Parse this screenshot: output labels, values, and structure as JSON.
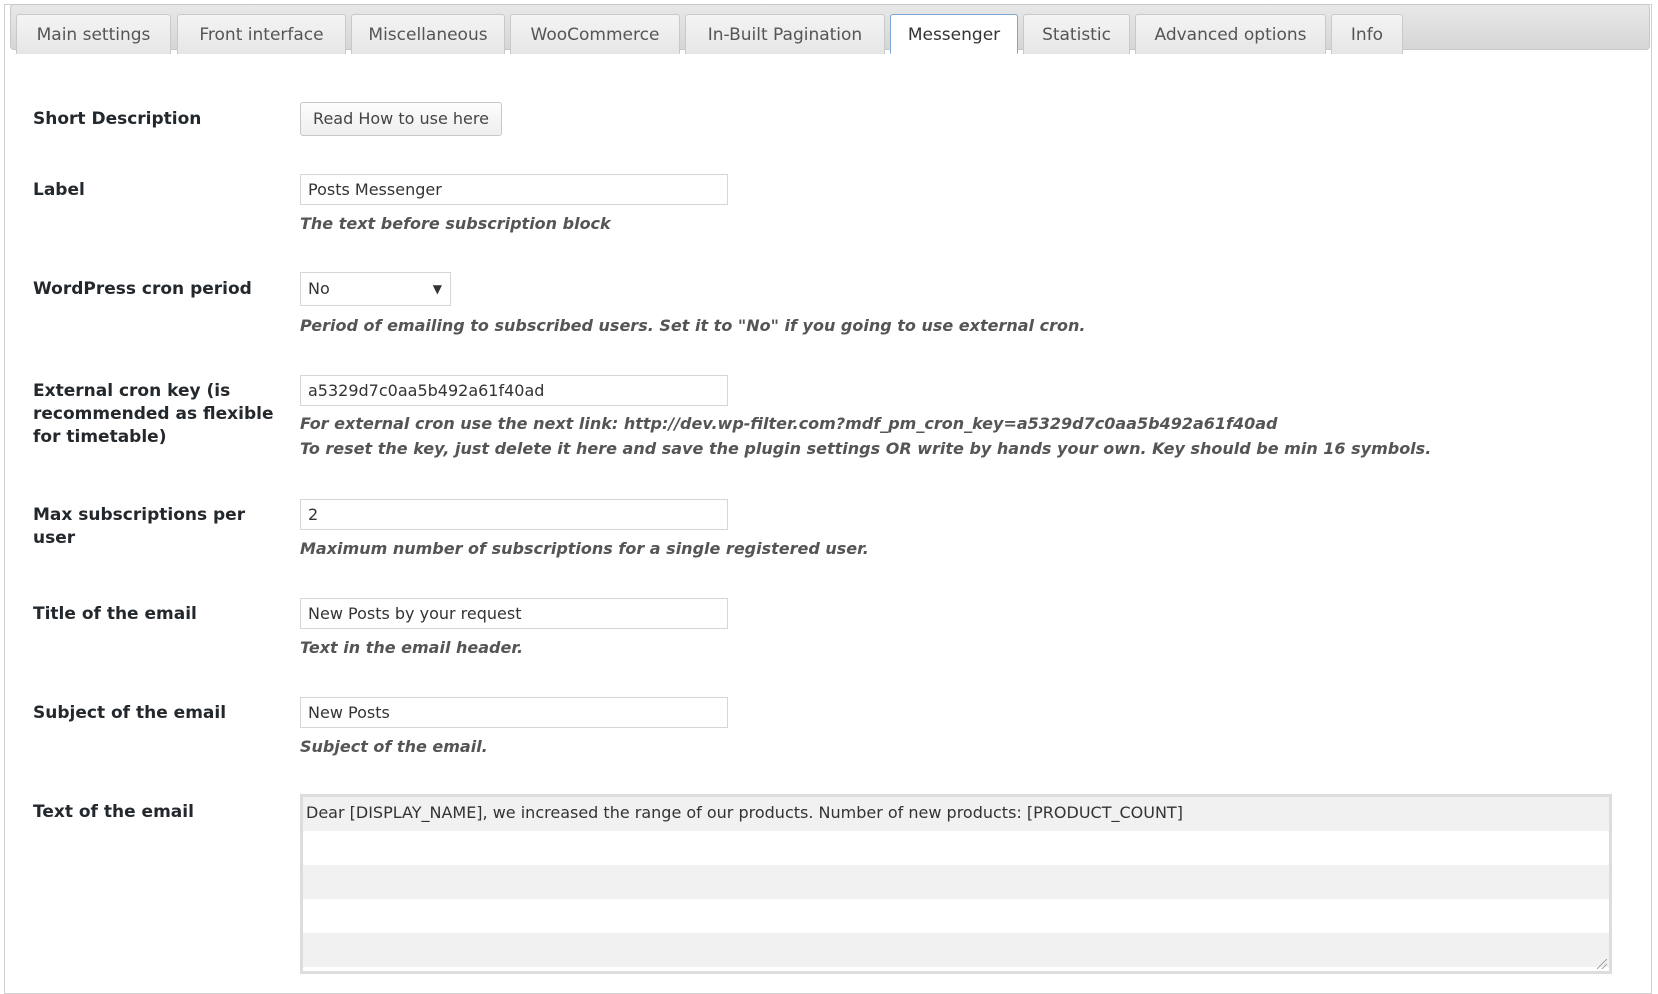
{
  "tabs": [
    {
      "label": "Main settings"
    },
    {
      "label": "Front interface"
    },
    {
      "label": "Miscellaneous"
    },
    {
      "label": "WooCommerce"
    },
    {
      "label": "In-Built Pagination"
    },
    {
      "label": "Messenger",
      "active": true
    },
    {
      "label": "Statistic"
    },
    {
      "label": "Advanced options"
    },
    {
      "label": "Info"
    }
  ],
  "fields": {
    "short_description": {
      "label": "Short Description",
      "button": "Read How to use here"
    },
    "label": {
      "label": "Label",
      "value": "Posts Messenger",
      "desc": "The text before subscription block"
    },
    "cron_period": {
      "label": "WordPress cron period",
      "value": "No",
      "desc": "Period of emailing to subscribed users. Set it to \"No\" if you going to use external cron."
    },
    "cron_key": {
      "label": "External cron key (is recommended as flexible for timetable)",
      "value": "a5329d7c0aa5b492a61f40ad",
      "desc1": "For external cron use the next link: http://dev.wp-filter.com?mdf_pm_cron_key=a5329d7c0aa5b492a61f40ad",
      "desc2": "To reset the key, just delete it here and save the plugin settings OR write by hands your own. Key should be min 16 symbols."
    },
    "max_subs": {
      "label": "Max subscriptions per user",
      "value": "2",
      "desc": "Maximum number of subscriptions for a single registered user."
    },
    "email_title": {
      "label": "Title of the email",
      "value": "New Posts by your request",
      "desc": "Text in the email header."
    },
    "email_subject": {
      "label": "Subject of the email",
      "value": "New Posts",
      "desc": "Subject of the email."
    },
    "email_text": {
      "label": "Text of the email",
      "value": "Dear [DISPLAY_NAME], we increased the range of our products. Number of new products: [PRODUCT_COUNT]"
    }
  }
}
